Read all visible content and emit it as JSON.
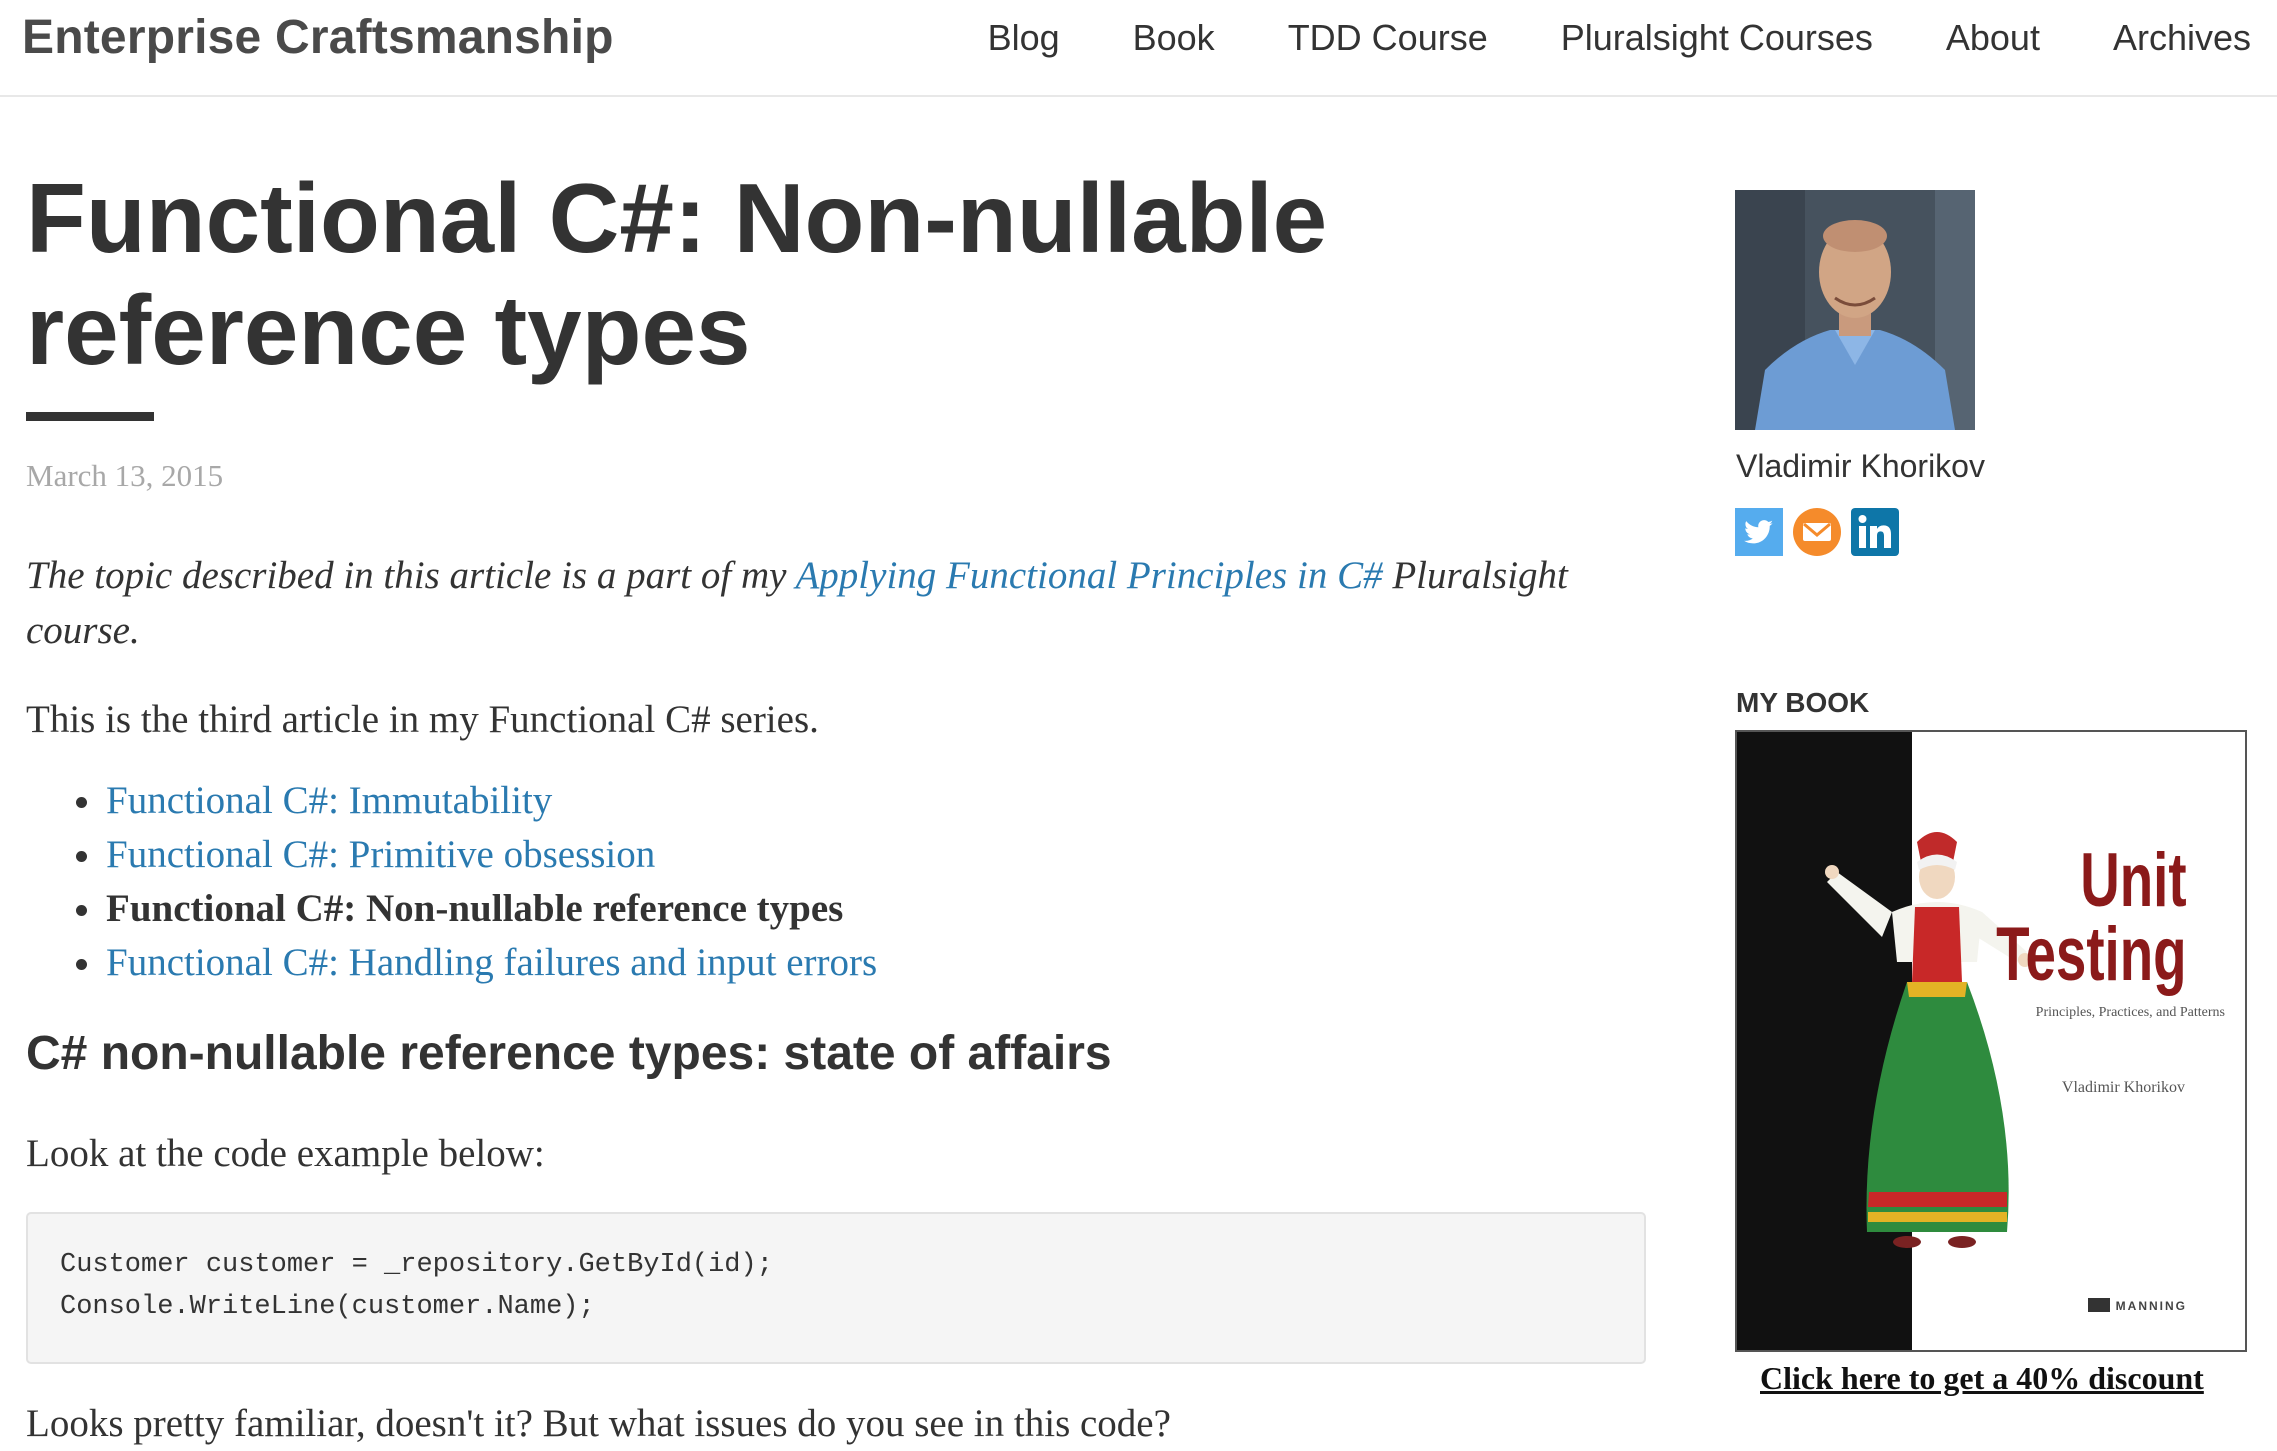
{
  "header": {
    "site_title": "Enterprise Craftsmanship",
    "nav": [
      "Blog",
      "Book",
      "TDD Course",
      "Pluralsight Courses",
      "About",
      "Archives"
    ]
  },
  "post": {
    "title": "Functional C#: Non-nullable reference types",
    "date": "March 13, 2015",
    "intro_before": "The topic described in this article is a part of my ",
    "intro_link": "Applying Functional Principles in C#",
    "intro_after": " Pluralsight course.",
    "series_text": "This is the third article in my Functional C# series.",
    "series": [
      {
        "label": "Functional C#: Immutability",
        "current": false
      },
      {
        "label": "Functional C#: Primitive obsession",
        "current": false
      },
      {
        "label": "Functional C#: Non-nullable reference types",
        "current": true
      },
      {
        "label": "Functional C#: Handling failures and input errors",
        "current": false
      }
    ],
    "section_heading": "C# non-nullable reference types: state of affairs",
    "code_intro": "Look at the code example below:",
    "code_lines": [
      "Customer customer = _repository.GetById(id);",
      "Console.WriteLine(customer.Name);"
    ],
    "cut_text": "Looks pretty familiar, doesn't it? But what issues do you see in this code?"
  },
  "sidebar": {
    "author_name": "Vladimir Khorikov",
    "social": [
      "twitter-icon",
      "email-icon",
      "linkedin-icon"
    ],
    "book_heading": "MY BOOK",
    "book": {
      "title_line1": "Unit",
      "title_line2": "Testing",
      "subtitle": "Principles, Practices, and Patterns",
      "author": "Vladimir Khorikov",
      "publisher": "MANNING"
    },
    "discount_link": "Click here to get a 40% discount"
  },
  "colors": {
    "link": "#2a7ab0",
    "text": "#333333",
    "book_title": "#8b1a1a",
    "twitter": "#55acee",
    "email": "#f58b2b",
    "linkedin": "#0e76a8"
  }
}
